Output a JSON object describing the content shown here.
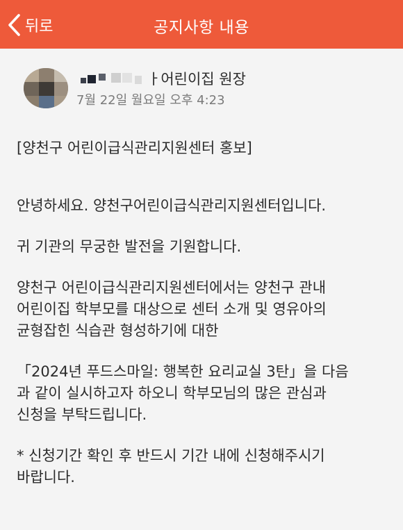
{
  "header": {
    "back_label": "뒤로",
    "title": "공지사항 내용",
    "bar_color": "#ee5a3a"
  },
  "author": {
    "name_visible": "ㅏ어린이집 원장",
    "datetime": "7월 22일 월요일 오후 4:23"
  },
  "post": {
    "subject": "[양천구 어린이급식관리지원센터 홍보]",
    "p1": "안녕하세요. 양천구어린이급식관리지원센터입니다.",
    "p2": "귀 기관의 무궁한 발전을 기원합니다.",
    "p3": [
      "양천구 어린이급식관리지원센터에서는 양천구 관내",
      "어린이집 학부모를 대상으로 센터 소개 및 영유아의",
      "균형잡힌 식습관 형성하기에 대한"
    ],
    "p4": [
      "「2024년 푸드스마일: 행복한 요리교실 3탄」을 다음",
      "과 같이 실시하고자 하오니 학부모님의 많은 관심과",
      "신청을 부탁드립니다."
    ],
    "p5": [
      "* 신청기간 확인 후 반드시 기간 내에 신청해주시기",
      "바랍니다."
    ]
  }
}
